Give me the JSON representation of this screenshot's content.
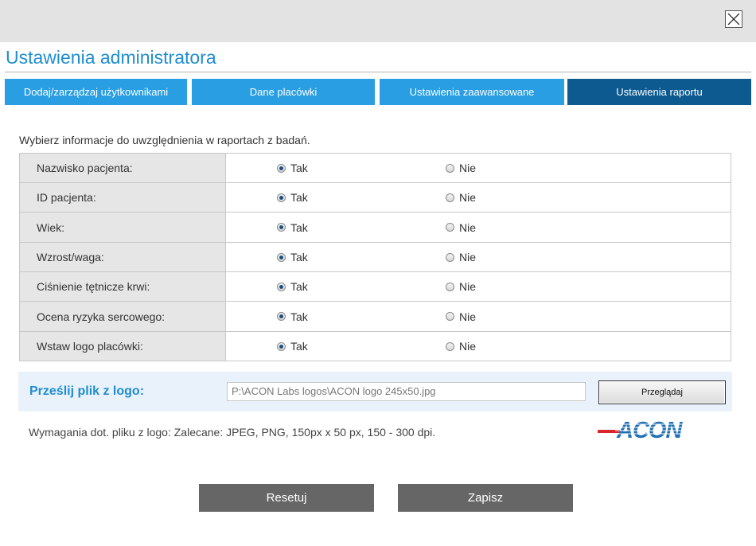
{
  "header": {
    "close_label": "X",
    "title": "Ustawienia administratora"
  },
  "tabs": [
    {
      "label": "Dodaj/zarządzaj użytkownikami",
      "active": false
    },
    {
      "label": "Dane placówki",
      "active": false
    },
    {
      "label": "Ustawienia zaawansowane",
      "active": false
    },
    {
      "label": "Ustawienia raportu",
      "active": true
    }
  ],
  "report": {
    "intro": "Wybierz informacje do uwzględnienia w raportach z badań.",
    "yes_label": "Tak",
    "no_label": "Nie",
    "rows": [
      {
        "label": "Nazwisko pacjenta:",
        "selected": "Tak"
      },
      {
        "label": "ID pacjenta:",
        "selected": "Tak"
      },
      {
        "label": "Wiek:",
        "selected": "Tak"
      },
      {
        "label": "Wzrost/waga:",
        "selected": "Tak"
      },
      {
        "label": "Ciśnienie tętnicze krwi:",
        "selected": "Tak"
      },
      {
        "label": "Ocena ryzyka sercowego:",
        "selected": "Tak"
      },
      {
        "label": "Wstaw logo placówki:",
        "selected": "Tak"
      }
    ]
  },
  "upload": {
    "label": "Prześlij plik z logo:",
    "file_path": "P:\\ACON Labs logos\\ACON logo 245x50.jpg",
    "browse_label": "Przeglądaj",
    "requirements": "Wymagania dot. pliku z logo: Zalecane: JPEG, PNG, 150px x 50 px, 150 - 300 dpi.",
    "logo_text": "ACON",
    "logo_color": "#1f6fb5",
    "logo_accent": "#d9252b"
  },
  "actions": {
    "reset_label": "Resetuj",
    "save_label": "Zapisz"
  },
  "colors": {
    "accent": "#1f8dcf",
    "tab": "#2a9ee2",
    "tab_active": "#0c5a90",
    "button": "#666666"
  }
}
